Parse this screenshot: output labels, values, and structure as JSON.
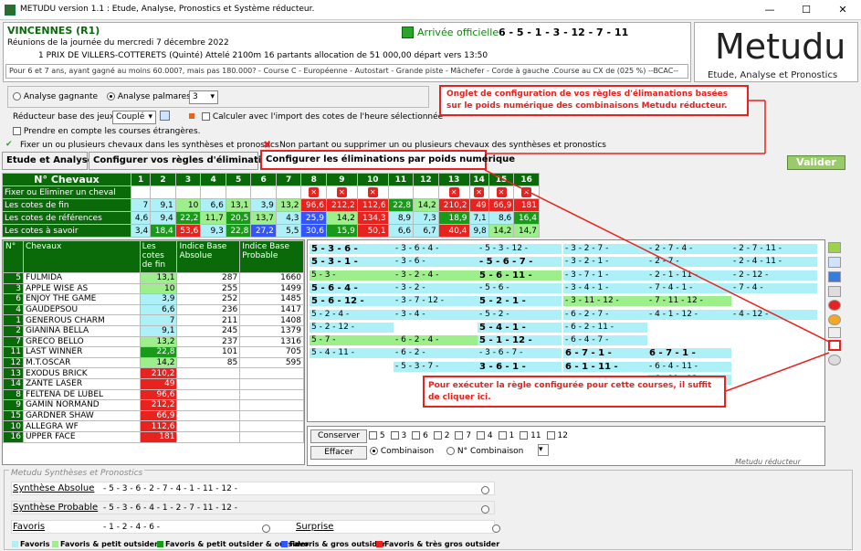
{
  "window": {
    "title": "METUDU version 1.1  : Etude, Analyse,  Pronostics et Système réducteur.",
    "min": "—",
    "max": "☐",
    "close": "✕"
  },
  "race": {
    "name": "VINCENNES (R1)",
    "reunion": "Réunions de la journée du mercredi 7 décembre 2022",
    "prix": "1 PRIX DE VILLERS-COTTERETS (Quinté) Attelé 2100m 16 partants allocation de 51 000,00 départ vers 13:50",
    "conditions": "Pour 6 et 7 ans, ayant gagné au moins 60.000?, mais pas 180.000? - Course C - Européenne - Autostart - Grande piste - Mâchefer - Corde à gauche .Course au CX de (025 %)  --BCAC--",
    "arrivee_label": "Arrivée officielle :",
    "arrivee": "6 - 5 - 1 - 3 - 12 - 7 - 11"
  },
  "logo": {
    "title": "Metudu",
    "subtitle": "Etude, Analyse et Pronostics"
  },
  "config": {
    "analyse_gagnante": "Analyse gagnante",
    "analyse_palmares": "Analyse palmares",
    "palmares_value": "3",
    "reducteur_label": "Réducteur base des jeux :",
    "reducteur_value": "Couplé",
    "calculer": "Calculer avec l'import des cotes de l'heure sélectionnée",
    "prendre": "Prendre en compte les courses étrangères.",
    "fixer": "Fixer un ou plusieurs chevaux dans les synthèses et pronostics",
    "non_partant": "Non partant ou supprimer un ou plusieurs chevaux des synthèses et pronostics"
  },
  "tabs": [
    "Etude et Analyse",
    "Configurer vos règles d'éliminations",
    "Configurer les éliminations par poids numérique"
  ],
  "valider": "Valider",
  "notes": {
    "n1": "Onglet de configuration de vos règles d'élimanations basées sur le poids numérique des combinaisons Metudu réducteur.",
    "n2": "Pour exécuter la règle configurée pour cette courses, il suffit de cliquer ici."
  },
  "grid": {
    "header": "N° Chevaux",
    "row_labels": [
      "Fixer ou Eliminer un cheval",
      "Les cotes de fin",
      "Les cotes de références",
      "Les cotes à savoir"
    ],
    "numbers": [
      "1",
      "2",
      "3",
      "4",
      "5",
      "6",
      "7",
      "8",
      "9",
      "10",
      "11",
      "12",
      "13",
      "14",
      "15",
      "16"
    ],
    "fin": [
      "7",
      "9,1",
      "10",
      "6,6",
      "13,1",
      "3,9",
      "13,2",
      "96,6",
      "212,2",
      "112,6",
      "22,8",
      "14,2",
      "210,2",
      "49",
      "66,9",
      "181"
    ],
    "ref": [
      "4,6",
      "9,4",
      "22,2",
      "11,7",
      "20,5",
      "13,7",
      "4,3",
      "25,9",
      "14,2",
      "134,3",
      "8,9",
      "7,3",
      "18,9",
      "7,1",
      "8,6",
      "16,4"
    ],
    "savoir": [
      "3,4",
      "18,4",
      "53,6",
      "9,3",
      "22,8",
      "27,2",
      "5,5",
      "30,6",
      "15,9",
      "50,1",
      "6,6",
      "6,7",
      "40,4",
      "9,8",
      "14,2",
      "14,7"
    ]
  },
  "horses": {
    "headers": [
      "N°",
      "Chevaux",
      "Les cotes de fin",
      "Indice Base Absolue",
      "Indice Base Probable"
    ],
    "rows": [
      [
        "5",
        "FULMIDA",
        "13,1",
        "287",
        "1660"
      ],
      [
        "3",
        "APPLE WISE AS",
        "10",
        "255",
        "1499"
      ],
      [
        "6",
        "ENJOY THE GAME",
        "3,9",
        "252",
        "1485"
      ],
      [
        "4",
        "GAUDEPSOU",
        "6,6",
        "236",
        "1417"
      ],
      [
        "1",
        "GENEROUS CHARM",
        "7",
        "211",
        "1408"
      ],
      [
        "2",
        "GIANINA BELLA",
        "9,1",
        "245",
        "1379"
      ],
      [
        "7",
        "GRECO BELLO",
        "13,2",
        "237",
        "1316"
      ],
      [
        "11",
        "LAST WINNER",
        "22,8",
        "101",
        "705"
      ],
      [
        "12",
        "M.T.OSCAR",
        "14,2",
        "85",
        "595"
      ],
      [
        "13",
        "EXODUS BRICK",
        "210,2",
        "",
        ""
      ],
      [
        "14",
        "ZANTE LASER",
        "49",
        "",
        ""
      ],
      [
        "8",
        "FELTENA DE LUBEL",
        "96,6",
        "",
        ""
      ],
      [
        "9",
        "GAMIN NORMAND",
        "212,2",
        "",
        ""
      ],
      [
        "15",
        "GARDNER SHAW",
        "66,9",
        "",
        ""
      ],
      [
        "10",
        "ALLEGRA WF",
        "112,6",
        "",
        ""
      ],
      [
        "16",
        "UPPER FACE",
        "181",
        "",
        ""
      ]
    ]
  },
  "combos": {
    "col1": [
      "5 - 3 - 6 -",
      "5 - 3 - 1 -",
      "5 - 3 -",
      "5 - 6 - 4 -",
      "5 - 6 - 12 -",
      "5 - 2 - 4 -",
      "5 - 2 - 12 -",
      "5 - 7 -",
      "5 - 4 - 11 -"
    ],
    "col2": [
      "- 3 - 6 - 4 -",
      "- 3 - 6 -",
      "- 3 - 2 - 4 -",
      "- 3 - 2 -",
      "- 3 - 7 - 12 -",
      "- 3 - 4 -",
      "",
      "- 6 - 2 - 4 -",
      "- 6 - 2 -",
      "- 5 - 3 - 7 -"
    ],
    "col3": [
      "- 5 - 3 - 12 -",
      "- 5 - 6 - 7 -",
      "5 - 6 - 11 -",
      "- 5 - 6 -",
      "5 - 2 - 1 -",
      "- 5 - 2 -",
      "5 - 4 - 1 -",
      "5 - 1 - 12 -",
      "- 3 - 6 - 7 -",
      "3 - 6 - 1 -"
    ],
    "col4": [
      "- 3 - 2 - 7 -",
      "- 3 - 2 - 1 -",
      "- 3 - 7 - 1 -",
      "- 3 - 4 - 1 -",
      "- 3 - 11 - 12 -",
      "- 6 - 2 - 7 -",
      "- 6 - 2 - 11 -",
      "- 6 - 4 - 7 -",
      "6 - 7 - 1 -",
      "6 - 1 - 11 -"
    ],
    "col5": [
      "- 2 - 7 - 4 -",
      "- 2 - 7 -",
      "- 2 - 1 - 11 -",
      "- 7 - 4 - 1 -",
      "- 7 - 11 - 12 -",
      "- 4 - 1 - 12 -",
      "",
      "",
      "6 - 7 - 1 -",
      "- 6 - 4 - 11 -",
      "- 6 - 11 - 12 -"
    ],
    "col6": [
      "- 2 - 7 - 11 -",
      "- 2 - 4 - 11 -",
      "- 2 - 12 -",
      "- 7 - 4 -",
      "",
      "- 4 - 12 -"
    ]
  },
  "bottom": {
    "conserver": "Conserver",
    "effacer": "Effacer",
    "checks": [
      "5",
      "3",
      "6",
      "2",
      "7",
      "4",
      "1",
      "11",
      "12"
    ],
    "combinaison": "Combinaison",
    "num_combinaison": "N° Combinaison",
    "footer": "Metudu réducteur"
  },
  "synth": {
    "title": "Metudu Synthèses et Pronostics",
    "absolue_label": "Synthèse Absolue",
    "absolue": "- 5 - 3 - 6 - 2 - 7 - 4 - 1 - 11 - 12 -",
    "probable_label": "Synthèse Probable",
    "probable": "- 5 - 3 - 6 - 4 - 1 - 2 - 7 - 11 - 12 -",
    "favoris_label": "Favoris",
    "favoris": "- 1 - 2 - 4 - 6 -",
    "surprise_label": "Surprise"
  },
  "legend": [
    "Favoris",
    "Favoris & petit outsider",
    "Favoris & petit outsider & outsider",
    "Favoris & gros outsider",
    "Favoris & très gros outsider"
  ],
  "colors": {
    "green_dark": "#0a6a0a",
    "red": "#e8221e",
    "light_blue": "#aef0f8",
    "light_green": "#9cef8a",
    "blue": "#3355ff"
  }
}
